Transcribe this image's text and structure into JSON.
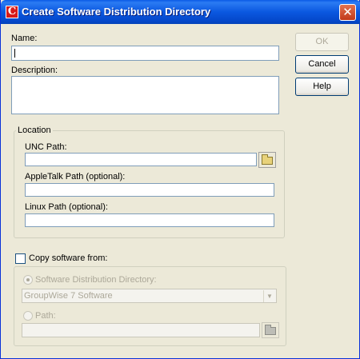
{
  "window": {
    "title": "Create Software Distribution Directory",
    "app_icon_glyph": "C",
    "close_glyph": "✕"
  },
  "form": {
    "name_label": "Name:",
    "name_value": "",
    "description_label": "Description:",
    "description_value": ""
  },
  "buttons": {
    "ok": "OK",
    "cancel": "Cancel",
    "help": "Help"
  },
  "location": {
    "legend": "Location",
    "unc_label": "UNC Path:",
    "unc_value": "",
    "appletalk_label": "AppleTalk Path (optional):",
    "appletalk_value": "",
    "linux_label": "Linux Path (optional):",
    "linux_value": ""
  },
  "copy": {
    "checkbox_label": "Copy software from:",
    "checked": false,
    "sdd_radio_label": "Software Distribution Directory:",
    "sdd_selected": "GroupWise 7 Software",
    "path_radio_label": "Path:",
    "path_value": ""
  },
  "icons": {
    "app": "novell-c-icon",
    "close": "close-icon",
    "browse": "folder-icon",
    "dropdown": "chevron-down-icon"
  }
}
